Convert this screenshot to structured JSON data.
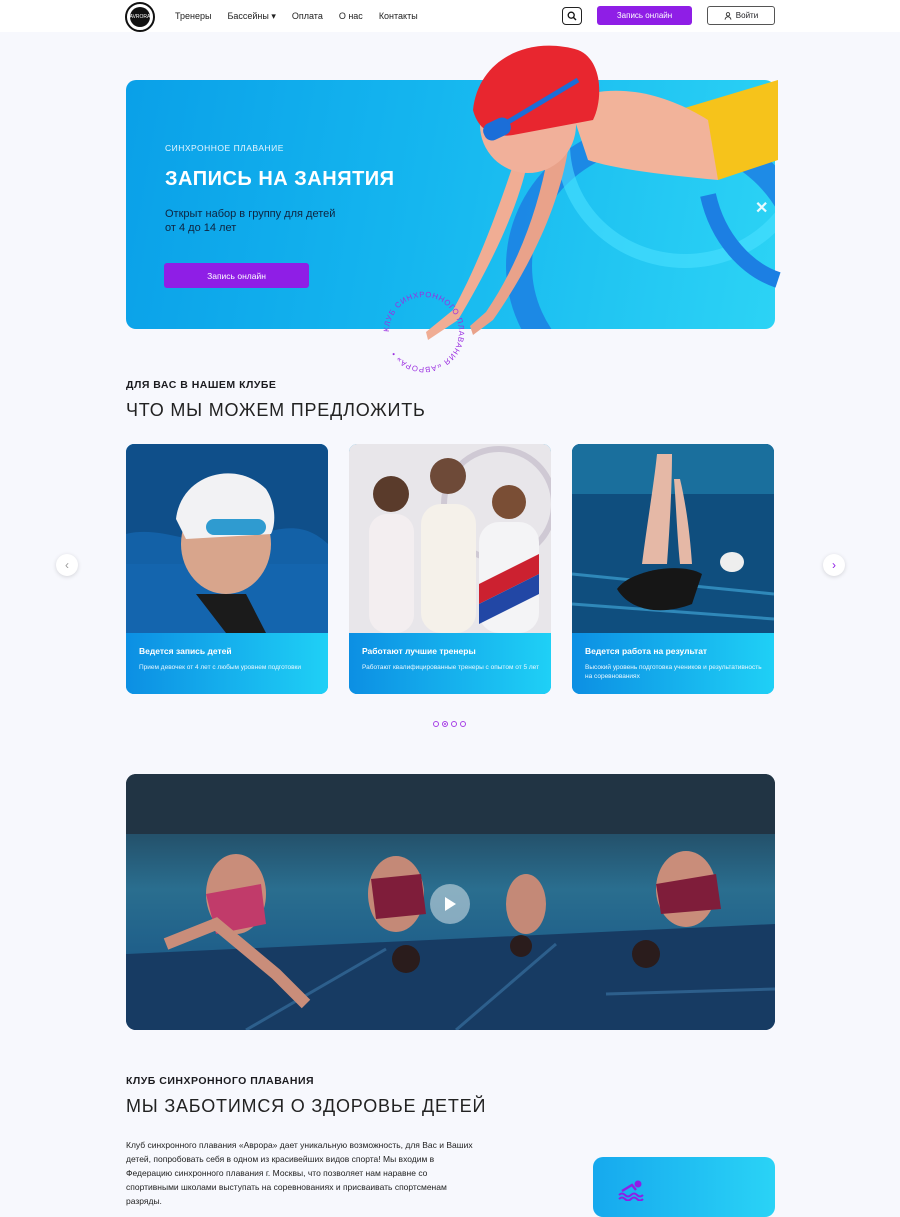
{
  "header": {
    "logo_text": "AVRORA",
    "nav": [
      "Тренеры",
      "Бассейны ▾",
      "Оплата",
      "О нас",
      "Контакты"
    ],
    "cta_label": "Запись онлайн",
    "login_label": "Войти"
  },
  "hero": {
    "eyebrow": "СИНХРОННОЕ ПЛАВАНИЕ",
    "title": "ЗАПИСЬ НА ЗАНЯТИЯ",
    "subtitle_line1": "Открыт набор в группу для детей",
    "subtitle_line2": "от 4 до 14 лет",
    "button_label": "Запись онлайн",
    "circle_text": "КЛУБ СИНХРОННОГО ПЛАВАНИЯ «АВРОРА» • "
  },
  "offer": {
    "eyebrow": "ДЛЯ ВАС В НАШЕМ КЛУБЕ",
    "title": "ЧТО МЫ МОЖЕМ ПРЕДЛОЖИТЬ",
    "cards": [
      {
        "title": "Ведется запись детей",
        "text": "Прием девочек от 4 лет с любым уровнем подготовки"
      },
      {
        "title": "Работают лучшие тренеры",
        "text": "Работают квалифицированные тренеры с опытом от 5 лет"
      },
      {
        "title": "Ведется работа на результат",
        "text": "Высокий уровень подготовка учеников и результативность на соревнованиях"
      }
    ],
    "active_dot": 2
  },
  "about": {
    "eyebrow": "КЛУБ СИНХРОННОГО ПЛАВАНИЯ",
    "title": "МЫ ЗАБОТИМСЯ О ЗДОРОВЬЕ ДЕТЕЙ",
    "text": "Клуб синхронного плавания «Аврора» дает уникальную возможность, для Вас и Ваших детей, попробовать себя в одном из красивейших видов спорта! Мы входим в Федерацию синхронного плавания г. Москвы, что позволяет нам наравне со спортивными школами выступать на соревнованиях и присваивать спортсменам разряды."
  },
  "colors": {
    "accent": "#8f1ee6",
    "blue": "#0aa0e8",
    "cyan": "#2ad3f6"
  }
}
